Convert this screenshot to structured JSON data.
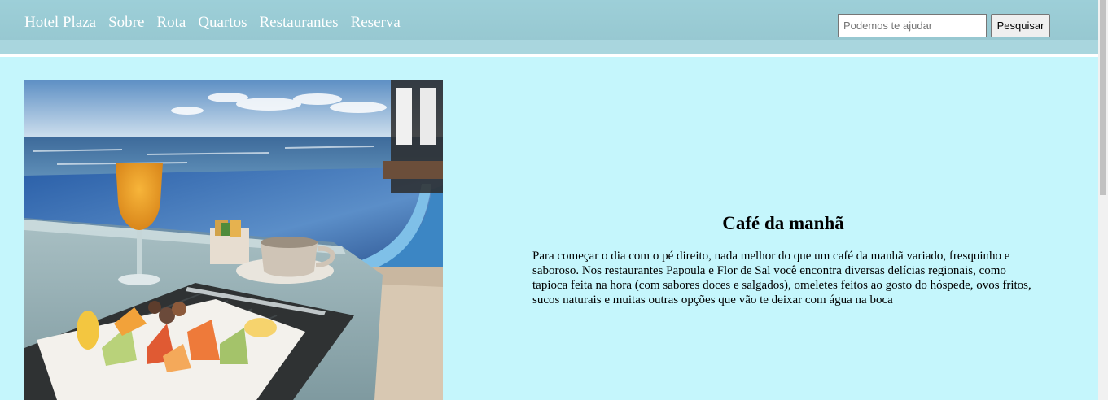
{
  "nav": {
    "brand": "Hotel Plaza",
    "links": [
      "Sobre",
      "Rota",
      "Quartos",
      "Restaurantes",
      "Reserva"
    ]
  },
  "search": {
    "placeholder": "Podemos te ajudar",
    "button_label": "Pesquisar"
  },
  "content": {
    "title": "Café da manhã",
    "text": "Para começar o dia com o pé direito, nada melhor do que um café da manhã variado, fresquinho e saboroso. Nos restaurantes Papoula e Flor de Sal você encontra diversas delícias regionais, como tapioca feita na hora (com sabores doces e salgados), omeletes feitos ao gosto do hóspede, ovos fritos, sucos naturais e muitas outras opções que vão te deixar com água na boca"
  },
  "colors": {
    "page_background": "#c5f6fc",
    "navbar": "#9dcfd8",
    "nav_text": "#ffffff"
  }
}
